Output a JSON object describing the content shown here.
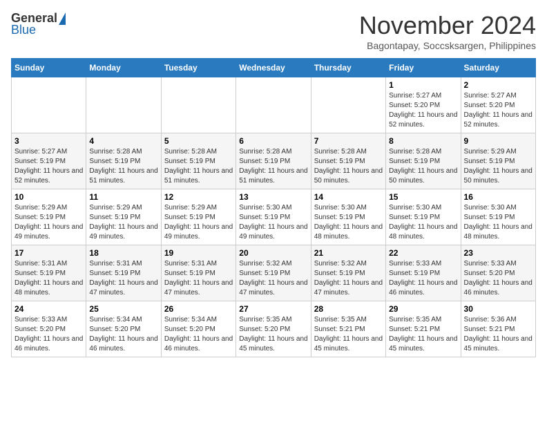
{
  "logo": {
    "general": "General",
    "blue": "Blue"
  },
  "title": "November 2024",
  "location": "Bagontapay, Soccsksargen, Philippines",
  "days_of_week": [
    "Sunday",
    "Monday",
    "Tuesday",
    "Wednesday",
    "Thursday",
    "Friday",
    "Saturday"
  ],
  "weeks": [
    [
      {
        "day": "",
        "info": ""
      },
      {
        "day": "",
        "info": ""
      },
      {
        "day": "",
        "info": ""
      },
      {
        "day": "",
        "info": ""
      },
      {
        "day": "",
        "info": ""
      },
      {
        "day": "1",
        "info": "Sunrise: 5:27 AM\nSunset: 5:20 PM\nDaylight: 11 hours and 52 minutes."
      },
      {
        "day": "2",
        "info": "Sunrise: 5:27 AM\nSunset: 5:20 PM\nDaylight: 11 hours and 52 minutes."
      }
    ],
    [
      {
        "day": "3",
        "info": "Sunrise: 5:27 AM\nSunset: 5:19 PM\nDaylight: 11 hours and 52 minutes."
      },
      {
        "day": "4",
        "info": "Sunrise: 5:28 AM\nSunset: 5:19 PM\nDaylight: 11 hours and 51 minutes."
      },
      {
        "day": "5",
        "info": "Sunrise: 5:28 AM\nSunset: 5:19 PM\nDaylight: 11 hours and 51 minutes."
      },
      {
        "day": "6",
        "info": "Sunrise: 5:28 AM\nSunset: 5:19 PM\nDaylight: 11 hours and 51 minutes."
      },
      {
        "day": "7",
        "info": "Sunrise: 5:28 AM\nSunset: 5:19 PM\nDaylight: 11 hours and 50 minutes."
      },
      {
        "day": "8",
        "info": "Sunrise: 5:28 AM\nSunset: 5:19 PM\nDaylight: 11 hours and 50 minutes."
      },
      {
        "day": "9",
        "info": "Sunrise: 5:29 AM\nSunset: 5:19 PM\nDaylight: 11 hours and 50 minutes."
      }
    ],
    [
      {
        "day": "10",
        "info": "Sunrise: 5:29 AM\nSunset: 5:19 PM\nDaylight: 11 hours and 49 minutes."
      },
      {
        "day": "11",
        "info": "Sunrise: 5:29 AM\nSunset: 5:19 PM\nDaylight: 11 hours and 49 minutes."
      },
      {
        "day": "12",
        "info": "Sunrise: 5:29 AM\nSunset: 5:19 PM\nDaylight: 11 hours and 49 minutes."
      },
      {
        "day": "13",
        "info": "Sunrise: 5:30 AM\nSunset: 5:19 PM\nDaylight: 11 hours and 49 minutes."
      },
      {
        "day": "14",
        "info": "Sunrise: 5:30 AM\nSunset: 5:19 PM\nDaylight: 11 hours and 48 minutes."
      },
      {
        "day": "15",
        "info": "Sunrise: 5:30 AM\nSunset: 5:19 PM\nDaylight: 11 hours and 48 minutes."
      },
      {
        "day": "16",
        "info": "Sunrise: 5:30 AM\nSunset: 5:19 PM\nDaylight: 11 hours and 48 minutes."
      }
    ],
    [
      {
        "day": "17",
        "info": "Sunrise: 5:31 AM\nSunset: 5:19 PM\nDaylight: 11 hours and 48 minutes."
      },
      {
        "day": "18",
        "info": "Sunrise: 5:31 AM\nSunset: 5:19 PM\nDaylight: 11 hours and 47 minutes."
      },
      {
        "day": "19",
        "info": "Sunrise: 5:31 AM\nSunset: 5:19 PM\nDaylight: 11 hours and 47 minutes."
      },
      {
        "day": "20",
        "info": "Sunrise: 5:32 AM\nSunset: 5:19 PM\nDaylight: 11 hours and 47 minutes."
      },
      {
        "day": "21",
        "info": "Sunrise: 5:32 AM\nSunset: 5:19 PM\nDaylight: 11 hours and 47 minutes."
      },
      {
        "day": "22",
        "info": "Sunrise: 5:33 AM\nSunset: 5:19 PM\nDaylight: 11 hours and 46 minutes."
      },
      {
        "day": "23",
        "info": "Sunrise: 5:33 AM\nSunset: 5:20 PM\nDaylight: 11 hours and 46 minutes."
      }
    ],
    [
      {
        "day": "24",
        "info": "Sunrise: 5:33 AM\nSunset: 5:20 PM\nDaylight: 11 hours and 46 minutes."
      },
      {
        "day": "25",
        "info": "Sunrise: 5:34 AM\nSunset: 5:20 PM\nDaylight: 11 hours and 46 minutes."
      },
      {
        "day": "26",
        "info": "Sunrise: 5:34 AM\nSunset: 5:20 PM\nDaylight: 11 hours and 46 minutes."
      },
      {
        "day": "27",
        "info": "Sunrise: 5:35 AM\nSunset: 5:20 PM\nDaylight: 11 hours and 45 minutes."
      },
      {
        "day": "28",
        "info": "Sunrise: 5:35 AM\nSunset: 5:21 PM\nDaylight: 11 hours and 45 minutes."
      },
      {
        "day": "29",
        "info": "Sunrise: 5:35 AM\nSunset: 5:21 PM\nDaylight: 11 hours and 45 minutes."
      },
      {
        "day": "30",
        "info": "Sunrise: 5:36 AM\nSunset: 5:21 PM\nDaylight: 11 hours and 45 minutes."
      }
    ]
  ]
}
